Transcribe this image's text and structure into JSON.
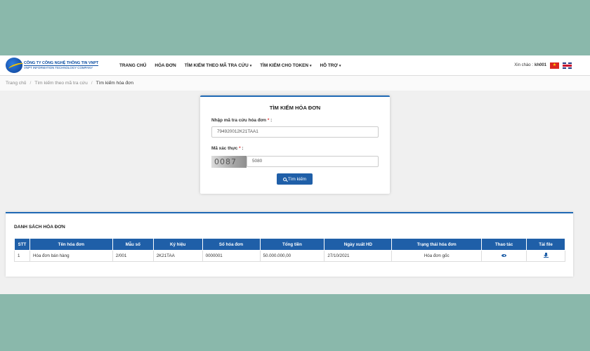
{
  "header": {
    "company_vi": "CÔNG TY CÔNG NGHỆ THÔNG TIN VNPT",
    "company_en": "VNPT INFORMATION TECHNOLOGY COMPANY",
    "nav": [
      {
        "label": "TRANG CHỦ",
        "caret": ""
      },
      {
        "label": "HÓA ĐƠN",
        "caret": ""
      },
      {
        "label": "TÌM KIẾM THEO MÃ TRA CỨU",
        "caret": "▾"
      },
      {
        "label": "TÌM KIẾM CHO TOKEN",
        "caret": "▾"
      },
      {
        "label": "HỖ TRỢ",
        "caret": "▾"
      }
    ],
    "greeting": "Xin chào :",
    "username": "kh001",
    "flag_vn_icon": "★"
  },
  "breadcrumb": {
    "items": [
      "Trang chủ",
      "Tìm kiếm theo mã tra cứu"
    ],
    "current": "Tìm kiếm hóa đơn",
    "separator": "/"
  },
  "search": {
    "title": "TÌM KIẾM HÓA ĐƠN",
    "lookup_label": "Nhập mã tra cứu hóa đơn",
    "lookup_value": "794920012K21TAA1",
    "captcha_label": "Mã xác thực",
    "required_mark": "*",
    "label_colon": ":",
    "captcha_image_text": "0087",
    "captcha_value": "5080",
    "button_label": "Tìm kiếm"
  },
  "invoice_list": {
    "title": "DANH SÁCH HÓA ĐƠN",
    "columns": [
      "STT",
      "Tên hóa đơn",
      "Mẫu số",
      "Ký hiệu",
      "Số hóa đơn",
      "Tổng tiền",
      "Ngày xuất HD",
      "Trạng thái hóa đơn",
      "Thao tác",
      "Tải file"
    ],
    "rows": [
      {
        "stt": "1",
        "name": "Hóa đơn bán hàng",
        "form": "2/001",
        "symbol": "2K21TAA",
        "number": "0000001",
        "total": "50.000.000,00",
        "date": "27/10/2021",
        "status": "Hóa đơn gốc",
        "view_icon": "eye-icon",
        "download_icon": "download-icon"
      }
    ]
  },
  "colors": {
    "page_background": "#8ab8ab",
    "primary": "#1f5fa8",
    "card_accent": "#1f69b4",
    "required": "#d33333"
  }
}
